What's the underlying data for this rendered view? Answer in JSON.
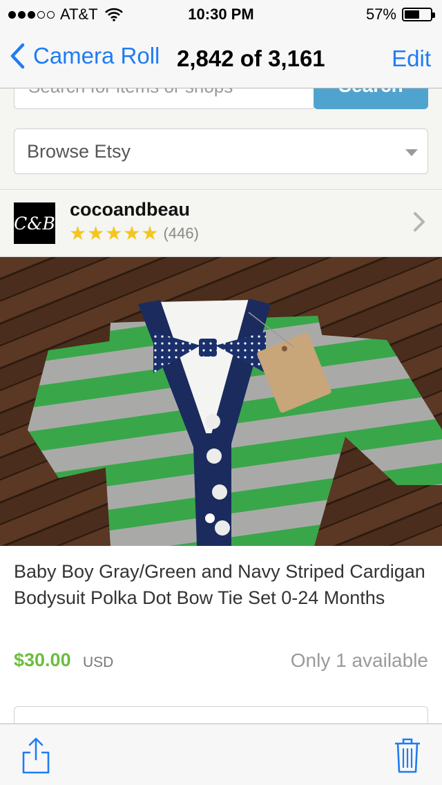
{
  "status_bar": {
    "carrier": "AT&T",
    "signal_bars": 3,
    "signal_total": 5,
    "time": "10:30 PM",
    "battery_text": "57%",
    "battery_level": 0.57
  },
  "nav": {
    "back_label": "Camera Roll",
    "title": "2,842 of 3,161",
    "edit_label": "Edit"
  },
  "search": {
    "placeholder": "Search for items or shops",
    "button_label": "Search"
  },
  "browse": {
    "selected": "Browse Etsy"
  },
  "shop": {
    "avatar_text": "C&B",
    "name": "cocoandbeau",
    "rating_stars": 5,
    "review_count": "(446)"
  },
  "listing": {
    "title": "Baby Boy Gray/Green and Navy Striped Cardigan Bodysuit Polka Dot Bow Tie Set 0-24 Months",
    "price": "$30.00",
    "currency": "USD",
    "availability": "Only 1 available"
  },
  "icons": {
    "back": "chevron-left-icon",
    "signal": "signal-dots-icon",
    "wifi": "wifi-icon",
    "battery": "battery-icon",
    "shop_chevron": "chevron-right-icon",
    "share": "share-icon",
    "trash": "trash-icon"
  },
  "colors": {
    "ios_blue": "#1e7cf2",
    "search_button": "#4fa4cf",
    "price_green": "#6bbd3e",
    "star_yellow": "#f5c51f"
  }
}
